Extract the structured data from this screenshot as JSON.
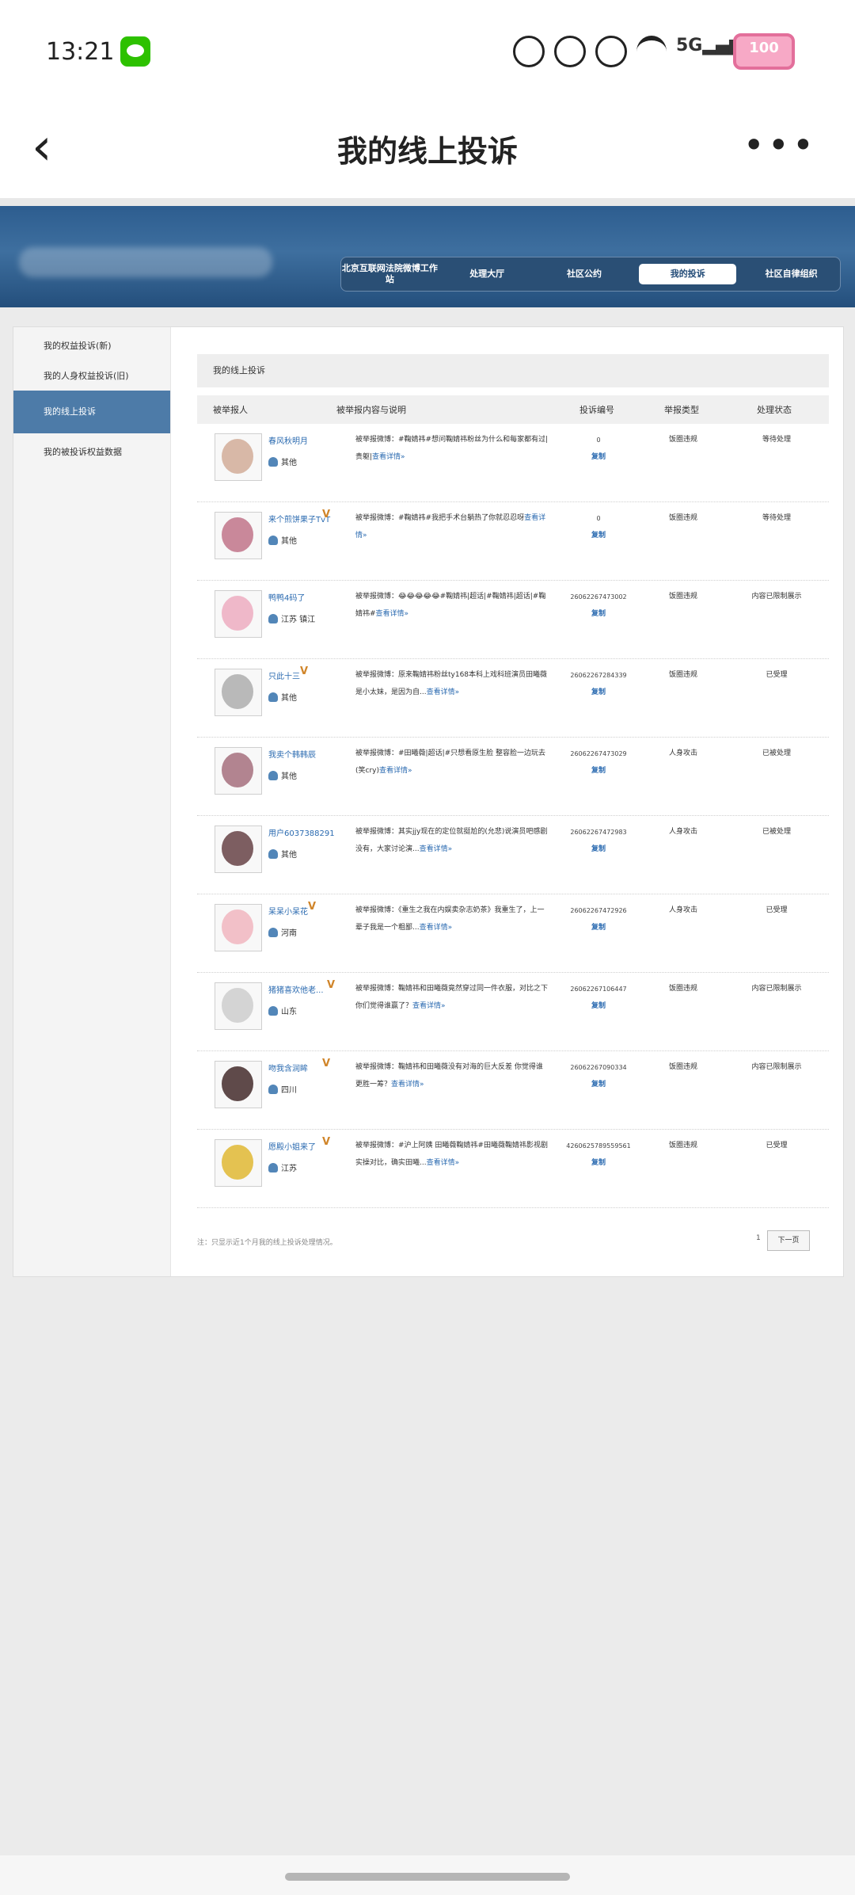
{
  "status_bar": {
    "time": "13:21",
    "battery": "100",
    "icons": [
      "wechat-icon",
      "pet-icon",
      "bug-icon",
      "face-icon",
      "wifi-icon",
      "signal-icon",
      "battery-icon"
    ]
  },
  "header": {
    "title": "我的线上投诉",
    "back_icon": "chevron-left-icon",
    "more_icon": "more-icon"
  },
  "site_nav": [
    "北京互联网法院微博工作站",
    "处理大厅",
    "社区公约",
    "我的投诉",
    "社区自律组织"
  ],
  "sidebar": {
    "items": [
      "我的权益投诉(新)",
      "我的人身权益投诉(旧)",
      "我的线上投诉",
      "我的被投诉权益数据"
    ]
  },
  "main": {
    "section_title": "我的线上投诉",
    "columns": [
      "被举报人",
      "被举报内容与说明",
      "投诉编号",
      "举报类型",
      "处理状态"
    ],
    "rows": [
      {
        "name": "春风秋明月",
        "location": "其他",
        "desc": "被举报微博：#鞠婧祎#想问鞠婧祎粉丝为什么和每家都有过|贵躯|",
        "more": "查看详情»",
        "number": "0",
        "copy": "复制",
        "type": "饭圈违规",
        "state": "等待处理"
      },
      {
        "name": "来个煎饼果子TvT",
        "location": "其他",
        "desc": "被举报微博：#鞠婧祎#我把手术台躺热了你就忍忍呀",
        "more": "查看详情»",
        "number": "0",
        "copy": "复制",
        "type": "饭圈违规",
        "state": "等待处理"
      },
      {
        "name": "鸭鸭4码了",
        "location": "江苏 镇江",
        "desc": "被举报微博：😂😂😂😂😂#鞠婧祎|超话|#鞠婧祎|超话|#鞠婧祎#",
        "more": "查看详情»",
        "number": "26062267473002",
        "copy": "复制",
        "type": "饭圈违规",
        "state": "内容已限制展示"
      },
      {
        "name": "只此十三",
        "location": "其他",
        "desc": "被举报微博：原来鞠婧祎粉丝ty168本科上戏科班演员田曦薇是小太妹，是因为自...",
        "more": "查看详情»",
        "number": "26062267284339",
        "copy": "复制",
        "type": "饭圈违规",
        "state": "已受理"
      },
      {
        "name": "我卖个韩韩辰",
        "location": "其他",
        "desc": "被举报微博：#田曦薇|超话|#只想看原生脸 整容脸一边玩去(笑cry)",
        "more": "查看详情»",
        "number": "26062267473029",
        "copy": "复制",
        "type": "人身攻击",
        "state": "已被处理"
      },
      {
        "name": "用户6037388291",
        "location": "其他",
        "desc": "被举报微博：其实jjy现在的定位就挺尬的(允悲)说演员吧感剧没有，大家讨论演...",
        "more": "查看详情»",
        "number": "26062267472983",
        "copy": "复制",
        "type": "人身攻击",
        "state": "已被处理"
      },
      {
        "name": "呆呆小呆花",
        "location": "河南",
        "desc": "被举报微博：《重生之我在内娱卖杂志奶茶》我重生了，上一辈子我是一个粗鄙...",
        "more": "查看详情»",
        "number": "26062267472926",
        "copy": "复制",
        "type": "人身攻击",
        "state": "已受理"
      },
      {
        "name": "猪猪喜欢他老...",
        "location": "山东",
        "desc": "被举报微博：鞠婧祎和田曦薇竟然穿过同一件衣服，对比之下你们觉得谁赢了？",
        "more": "查看详情»",
        "number": "26062267106447",
        "copy": "复制",
        "type": "饭圈违规",
        "state": "内容已限制展示"
      },
      {
        "name": "吻我含润眸",
        "location": "四川",
        "desc": "被举报微博：鞠婧祎和田曦薇没有对海的巨大反差 你觉得谁更胜一筹？",
        "more": "查看详情»",
        "number": "26062267090334",
        "copy": "复制",
        "type": "饭圈违规",
        "state": "内容已限制展示"
      },
      {
        "name": "愿殿小姐来了",
        "location": "江苏",
        "desc": "被举报微博：#沪上阿姨 田曦薇鞠婧祎#田曦薇鞠婧祎影视剧实操对比，确实田曦...",
        "more": "查看详情»",
        "number": "4260625789559561",
        "copy": "复制",
        "type": "饭圈违规",
        "state": "已受理"
      }
    ],
    "footer_note": "注：只显示近1个月我的线上投诉处理情况。",
    "page_number": "1",
    "next_button": "下一页"
  }
}
